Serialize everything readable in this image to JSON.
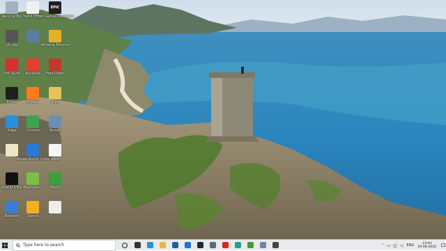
{
  "colors": {
    "sky": "#dbe6ef",
    "sea": "#2f8fc4",
    "taskbar": "#e9eaec"
  },
  "desktop_icons": [
    {
      "name": "recycle-bin-icon",
      "label": "Recycle Bin",
      "color": "#9fb3c4"
    },
    {
      "name": "file-icon",
      "label": "Tamil PC32",
      "color": "#f1f1f1"
    },
    {
      "name": "epic-games-icon",
      "label": "Epic Games Launcher",
      "color": "#202020",
      "glyph": "EPIC"
    },
    {
      "name": "image-icon",
      "label": "vlc.jpg",
      "color": "#555"
    },
    {
      "name": "monitor-icon",
      "label": "",
      "color": "#5a7ea0"
    },
    {
      "name": "winamp-icon",
      "label": "Winamp Monitor",
      "color": "#e5b12b"
    },
    {
      "name": "app-red-icon",
      "label": "TAK Suite",
      "color": "#d92f2f"
    },
    {
      "name": "anydesk-icon",
      "label": "AnyDesk",
      "color": "#e2402d"
    },
    {
      "name": "app-dark-icon",
      "label": "Free Down",
      "color": "#c0392b"
    },
    {
      "name": "app-star-icon",
      "label": "Emby",
      "color": "#1f1f1f"
    },
    {
      "name": "firefox-icon",
      "label": "Firefox",
      "color": "#ff7a1a"
    },
    {
      "name": "folder-icon",
      "label": "Files",
      "color": "#e6c25a"
    },
    {
      "name": "edge-icon",
      "label": "Edge",
      "color": "#2b8fe0"
    },
    {
      "name": "chrome-icon",
      "label": "Chrome",
      "color": "#3fa34d"
    },
    {
      "name": "people-icon",
      "label": "Person",
      "color": "#6a8fb3"
    },
    {
      "name": "doc-icon",
      "label": "",
      "color": "#efe6c8"
    },
    {
      "name": "vscode-icon",
      "label": "Visual Studio Code",
      "color": "#2a7ad5"
    },
    {
      "name": "txt-icon",
      "label": "Idea",
      "color": "#f5f5f5"
    },
    {
      "name": "intellij-icon",
      "label": "IntelliJ IDEA",
      "color": "#111"
    },
    {
      "name": "bluestacks-icon",
      "label": "BlueStacks",
      "color": "#7ac143"
    },
    {
      "name": "app-green-icon",
      "label": "Multi",
      "color": "#3c9e3c"
    },
    {
      "name": "app-circle-icon",
      "label": "Browser",
      "color": "#3a7bd5"
    },
    {
      "name": "app-yellow-icon",
      "label": "Opera",
      "color": "#f2b01e"
    },
    {
      "name": "blank-file-icon",
      "label": "",
      "color": "#eeeeee"
    }
  ],
  "taskbar": {
    "search_placeholder": "Type here to search",
    "apps": [
      {
        "name": "cortana-icon",
        "color": "#222"
      },
      {
        "name": "task-view-icon",
        "color": "#333"
      },
      {
        "name": "edge-taskbar-icon",
        "color": "#2b8fe0"
      },
      {
        "name": "file-explorer-icon",
        "color": "#e6b93c"
      },
      {
        "name": "store-icon",
        "color": "#1f5fa8"
      },
      {
        "name": "app-blue-taskbar-icon",
        "color": "#1b72d0"
      },
      {
        "name": "terminal-taskbar-icon",
        "color": "#1e2a3a"
      },
      {
        "name": "app-grey-taskbar-icon",
        "color": "#5b6b7a"
      },
      {
        "name": "opera-taskbar-icon",
        "color": "#d6281e"
      },
      {
        "name": "app-teal-taskbar-icon",
        "color": "#2f9a8f"
      },
      {
        "name": "app-green-taskbar-icon",
        "color": "#3c9e3c"
      },
      {
        "name": "photos-taskbar-icon",
        "color": "#6b86a8"
      },
      {
        "name": "app-dark-taskbar-icon",
        "color": "#444"
      }
    ],
    "language": "ENG",
    "time": "23:04",
    "date": "29-08-2020"
  }
}
